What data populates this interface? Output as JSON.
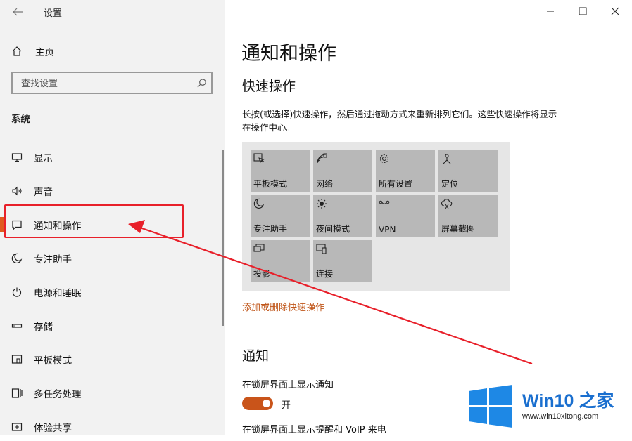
{
  "window": {
    "back_icon": "arrow-left-icon",
    "title": "设置",
    "controls": [
      "minimize-icon",
      "maximize-icon",
      "close-icon"
    ]
  },
  "sidebar": {
    "home_label": "主页",
    "search_placeholder": "查找设置",
    "section_label": "系统",
    "items": [
      {
        "label": "显示",
        "icon": "monitor-icon"
      },
      {
        "label": "声音",
        "icon": "speaker-icon"
      },
      {
        "label": "通知和操作",
        "icon": "message-icon",
        "active": true
      },
      {
        "label": "专注助手",
        "icon": "moon-icon"
      },
      {
        "label": "电源和睡眠",
        "icon": "power-icon"
      },
      {
        "label": "存储",
        "icon": "storage-icon"
      },
      {
        "label": "平板模式",
        "icon": "tablet-icon"
      },
      {
        "label": "多任务处理",
        "icon": "multitask-icon"
      },
      {
        "label": "体验共享",
        "icon": "share-icon"
      }
    ]
  },
  "main": {
    "title": "通知和操作",
    "quick_actions": {
      "heading": "快速操作",
      "description": "长按(或选择)快速操作，然后通过拖动方式来重新排列它们。这些快速操作将显示在操作中心。",
      "tiles": [
        {
          "label": "平板模式",
          "icon": "tablet-mode-icon"
        },
        {
          "label": "网络",
          "icon": "network-icon"
        },
        {
          "label": "所有设置",
          "icon": "gear-icon"
        },
        {
          "label": "定位",
          "icon": "location-icon"
        },
        {
          "label": "专注助手",
          "icon": "moon-icon"
        },
        {
          "label": "夜间模式",
          "icon": "brightness-icon"
        },
        {
          "label": "VPN",
          "icon": "vpn-icon"
        },
        {
          "label": "屏幕截图",
          "icon": "snip-icon"
        },
        {
          "label": "投影",
          "icon": "project-icon"
        },
        {
          "label": "连接",
          "icon": "connect-icon"
        }
      ],
      "edit_link": "添加或删除快速操作"
    },
    "notifications": {
      "heading": "通知",
      "lock_screen_label": "在锁屏界面上显示通知",
      "toggle_state": "开",
      "toggle_on": true,
      "next_label": "在锁屏界面上显示提醒和 VoIP 来电"
    }
  },
  "watermark": {
    "brand": "Win10 之家",
    "url": "www.win10xitong.com"
  },
  "colors": {
    "accent": "#c9541a",
    "annotation": "#e8202a",
    "tile": "#b8b8b8",
    "sidebar_bg": "#f2f2f2",
    "watermark_blue": "#1a6fcf"
  }
}
